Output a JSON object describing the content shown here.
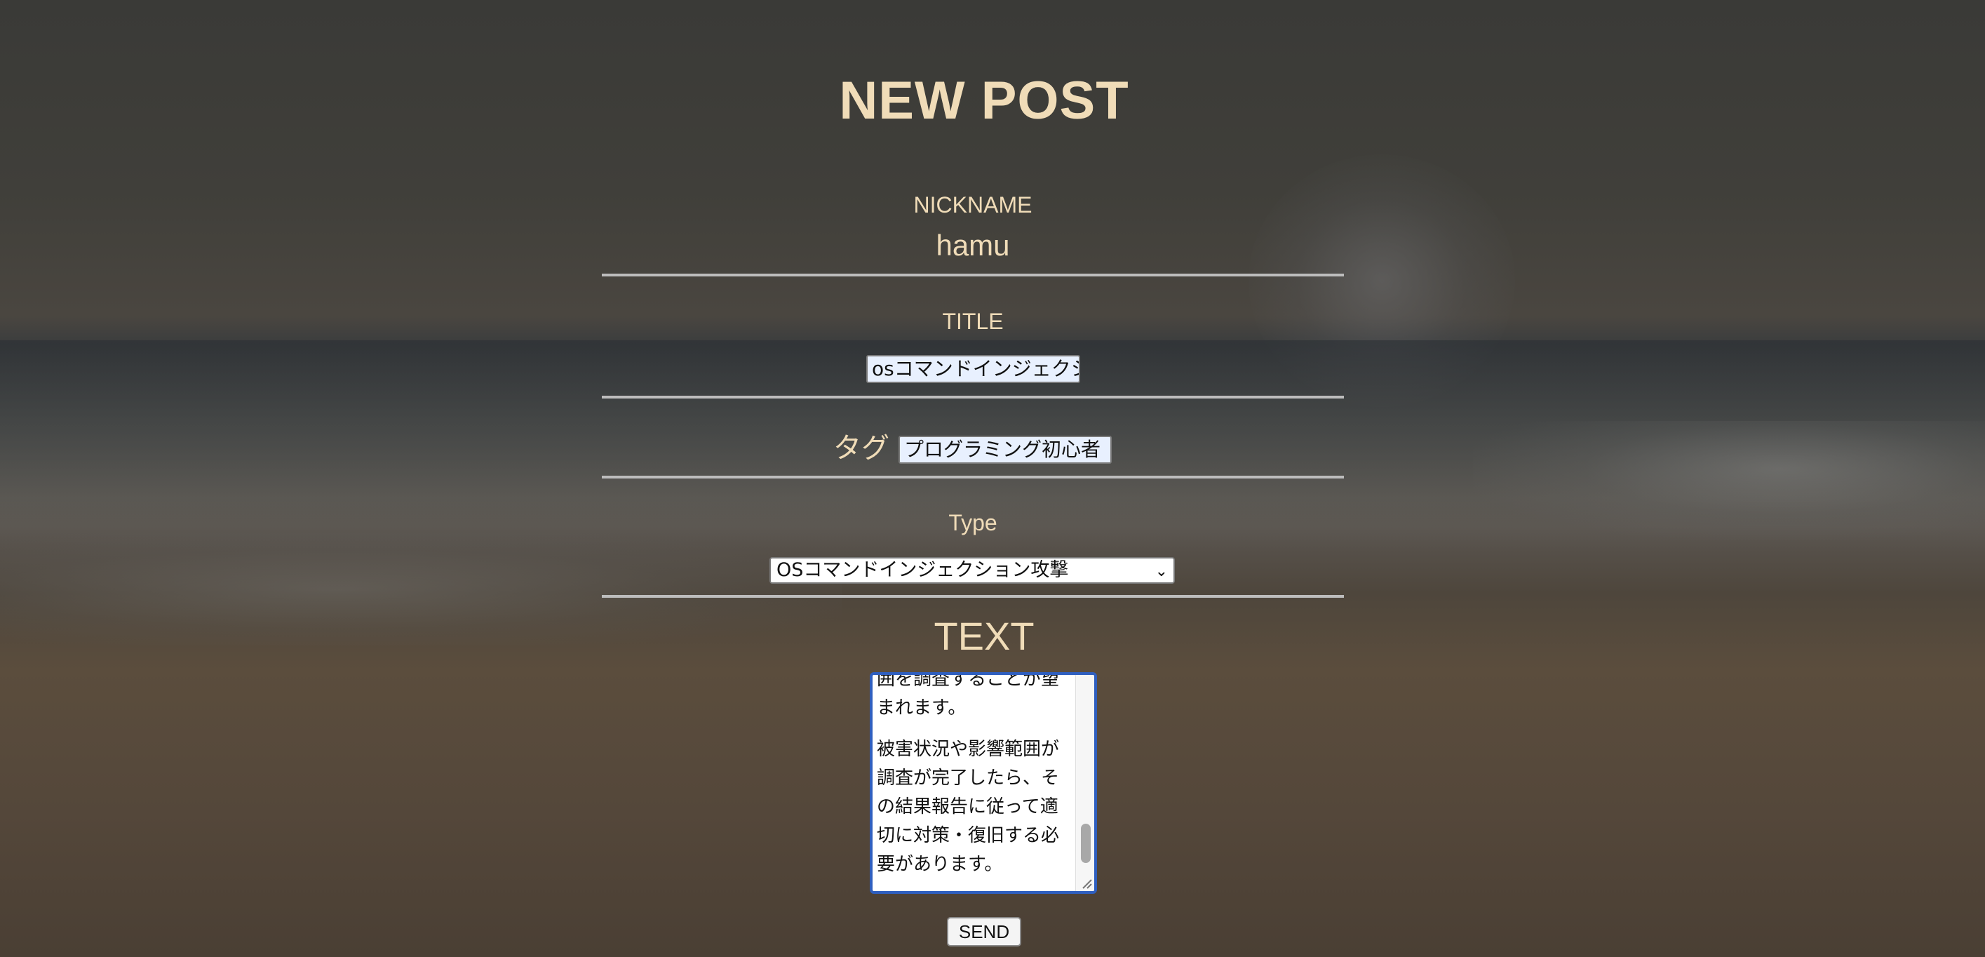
{
  "header": {
    "title": "NEW POST"
  },
  "form": {
    "nickname": {
      "label": "NICKNAME",
      "value": "hamu"
    },
    "title": {
      "label": "TITLE",
      "value": "osコマンドインジェクシ"
    },
    "tag": {
      "label": "タグ",
      "value": "プログラミング初心者"
    },
    "type": {
      "label": "Type",
      "selected": "OSコマンドインジェクション攻撃"
    },
    "text": {
      "label": "TEXT",
      "visible_lines": [
        "囲を調査することが望",
        "まれます。",
        "被害状況や影響範囲が",
        "調査が完了したら、そ",
        "の結果報告に従って適",
        "切に対策・復旧する必",
        "要があります。"
      ]
    },
    "send_label": "SEND"
  },
  "colors": {
    "accent_text": "#f0dcb8",
    "divider": "#bdbdbd",
    "focus_border": "#2f5fbf",
    "autofill_bg": "#e8f0fe"
  }
}
